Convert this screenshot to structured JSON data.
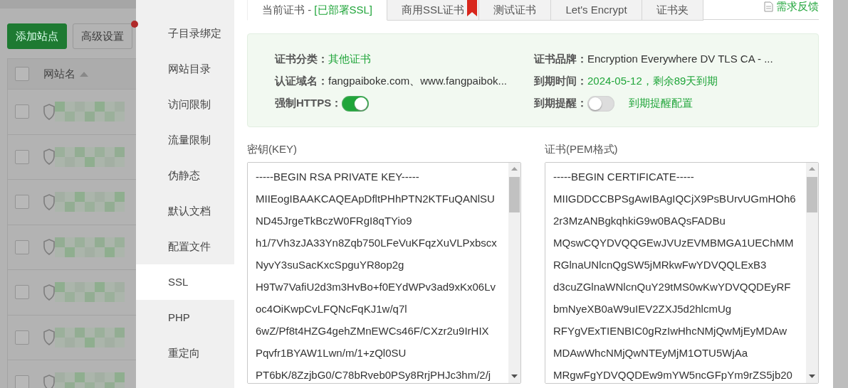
{
  "background": {
    "buttons": [
      {
        "label": "添加站点",
        "kind": "primary"
      },
      {
        "label": "高级设置",
        "kind": "default"
      }
    ],
    "table": {
      "header": {
        "label": "网站名",
        "checked": false
      },
      "rows": [
        {
          "checked": false
        },
        {
          "checked": false
        },
        {
          "checked": false
        },
        {
          "checked": false
        },
        {
          "checked": false
        },
        {
          "checked": false
        },
        {
          "checked": false
        }
      ]
    }
  },
  "sidebar": {
    "items": [
      {
        "label": "子目录绑定",
        "selected": false
      },
      {
        "label": "网站目录",
        "selected": false
      },
      {
        "label": "访问限制",
        "selected": false
      },
      {
        "label": "流量限制",
        "selected": false
      },
      {
        "label": "伪静态",
        "selected": false
      },
      {
        "label": "默认文档",
        "selected": false
      },
      {
        "label": "配置文件",
        "selected": false
      },
      {
        "label": "SSL",
        "selected": true
      },
      {
        "label": "PHP",
        "selected": false
      },
      {
        "label": "重定向",
        "selected": false
      }
    ]
  },
  "tabs": [
    {
      "label": "当前证书 - ",
      "status": "[已部署SSL]",
      "selected": true,
      "ribbon": false
    },
    {
      "label": "商用SSL证书",
      "selected": false,
      "ribbon": true
    },
    {
      "label": "测试证书",
      "selected": false,
      "ribbon": false
    },
    {
      "label": "Let's Encrypt",
      "selected": false,
      "ribbon": false
    },
    {
      "label": "证书夹",
      "selected": false,
      "ribbon": false
    }
  ],
  "feedback_link": "需求反馈",
  "info": {
    "left": [
      {
        "kind": "text",
        "label": "证书分类：",
        "value": "其他证书",
        "accent": true
      },
      {
        "kind": "text",
        "label": "认证域名：",
        "value": "fangpaiboke.com、www.fangpaibok...",
        "accent": false
      },
      {
        "kind": "switch",
        "label": "强制HTTPS：",
        "on": true
      }
    ],
    "right": [
      {
        "kind": "text",
        "label": "证书品牌：",
        "value": "Encryption Everywhere DV TLS CA - ...",
        "accent": false
      },
      {
        "kind": "text",
        "label": "到期时间：",
        "value": "2024-05-12，剩余89天到期",
        "accent": true
      },
      {
        "kind": "switch",
        "label": "到期提醒：",
        "on": false,
        "link": "到期提醒配置"
      }
    ]
  },
  "key": {
    "label": "密钥(KEY)",
    "lines": [
      "-----BEGIN RSA PRIVATE KEY-----",
      "MIIEogIBAAKCAQEApDfltPHhPTN2KTFuQANlSU",
      "ND45JrgeTkBczW0FRgI8qTYio9",
      "h1/7Vh3zJA33Yn8Zqb750LFeVuKFqzXuVLPxbscx",
      "NyvY3suSacKxcSpguYR8op2g",
      "H9Tw7VafiU2d3m3HvBo+f0EYdWPv3ad9xKx06Lv",
      "oc4OiKwpCvLFQNcFqKJ1w/q7l",
      "6wZ/Pf8t4HZG4gehZMnEWCs46F/CXzr2u9IrHIX",
      "Pqvfr1BYAW1Lwn/m/1+zQl0SU",
      "PT6bK/8ZzjbG0/C78bRveb0PSy8RrjPHJc3hm/2/j"
    ]
  },
  "certificate": {
    "label": "证书(PEM格式)",
    "lines": [
      "-----BEGIN CERTIFICATE-----",
      "MIIGDDCCBPSgAwIBAgIQCjX9PsBUrvUGmHOh6",
      "2r3MzANBgkqhkiG9w0BAQsFADBu",
      "MQswCQYDVQQGEwJVUzEVMBMGA1UEChMM",
      "RGlnaUNlcnQgSW5jMRkwFwYDVQQLExB3",
      "d3cuZGlnaWNlcnQuY29tMS0wKwYDVQQDEyRF",
      "bmNyeXB0aW9uIEV2ZXJ5d2hlcmUg",
      "RFYgVExTIENBIC0gRzIwHhcNMjQwMjEyMDAw",
      "MDAwWhcNMjQwNTEyMjM1OTU5WjAa",
      "MRgwFgYDVQQDEw9mYW5ncGFpYm9rZS5jb20"
    ]
  }
}
